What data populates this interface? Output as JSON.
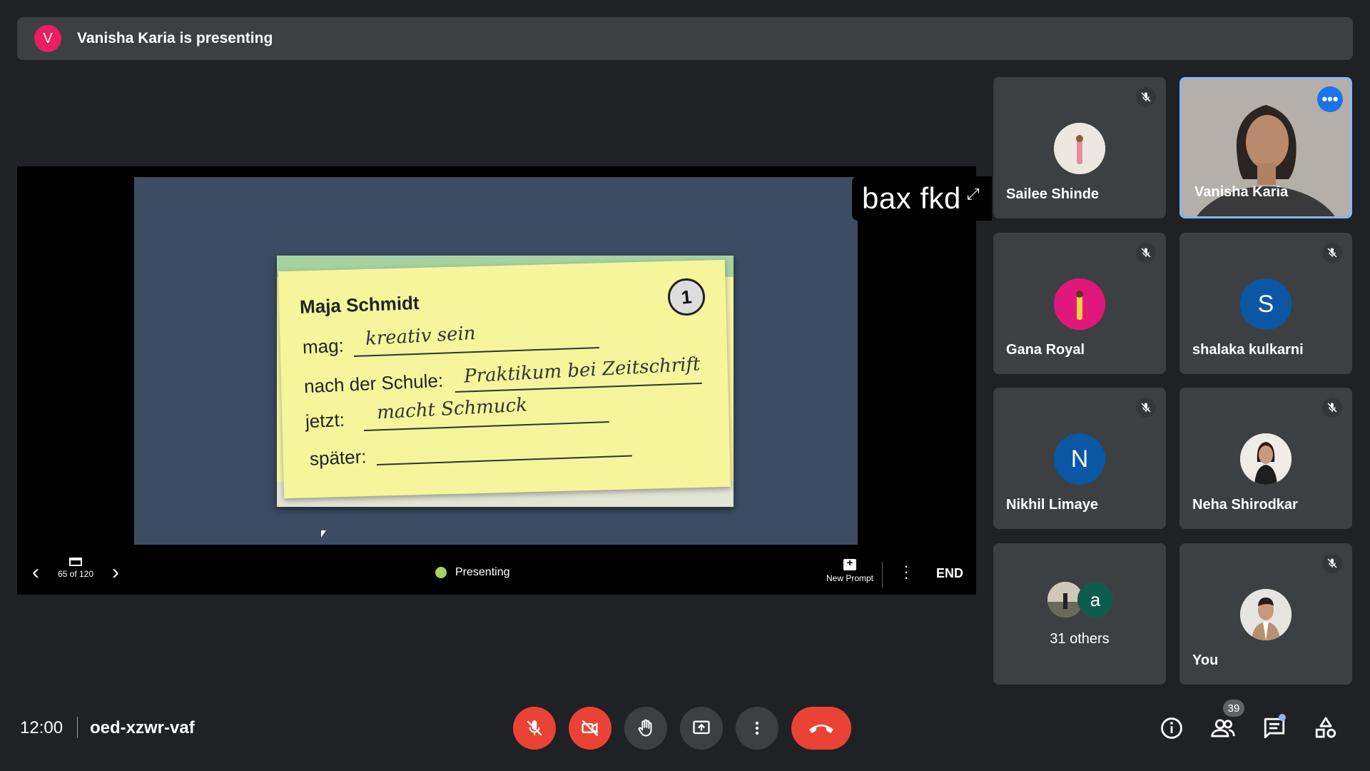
{
  "banner": {
    "avatar_letter": "V",
    "text": "Vanisha Karia is presenting"
  },
  "slide": {
    "brand": "bax fkd",
    "note": {
      "name": "Maja Schmidt",
      "number": "1",
      "rows": [
        {
          "label": "mag:",
          "value": "kreativ sein"
        },
        {
          "label": "nach der Schule:",
          "value": "Praktikum bei Zeitschrift"
        },
        {
          "label": "jetzt:",
          "value": "macht Schmuck"
        },
        {
          "label": "später:",
          "value": ""
        }
      ]
    }
  },
  "presenter_controls": {
    "page_indicator": "65 of 120",
    "status": "Presenting",
    "new_prompt_label": "New Prompt",
    "end_label": "END"
  },
  "participants": [
    {
      "name": "Sailee Shinde",
      "muted": true,
      "avatar": "photo"
    },
    {
      "name": "Vanisha Karia",
      "muted": false,
      "avatar": "video",
      "active": true
    },
    {
      "name": "Gana Royal",
      "muted": true,
      "avatar": "photo"
    },
    {
      "name": "shalaka kulkarni",
      "muted": true,
      "avatar_letter": "S",
      "avatar_color": "#0b57a4"
    },
    {
      "name": "Nikhil Limaye",
      "muted": true,
      "avatar_letter": "N",
      "avatar_color": "#0b57a4"
    },
    {
      "name": "Neha Shirodkar",
      "muted": true,
      "avatar": "photo"
    },
    {
      "name": "31 others",
      "avatar_letter": "a",
      "avatar_color": "#0d5c4d"
    },
    {
      "name": "You",
      "muted": true,
      "avatar": "photo"
    }
  ],
  "bottom_bar": {
    "time": "12:00",
    "meeting_code": "oed-xzwr-vaf",
    "people_count": "39"
  },
  "colors": {
    "background": "#202124",
    "tile": "#3c4043",
    "danger": "#ea4335",
    "accent": "#8ab4f8"
  }
}
